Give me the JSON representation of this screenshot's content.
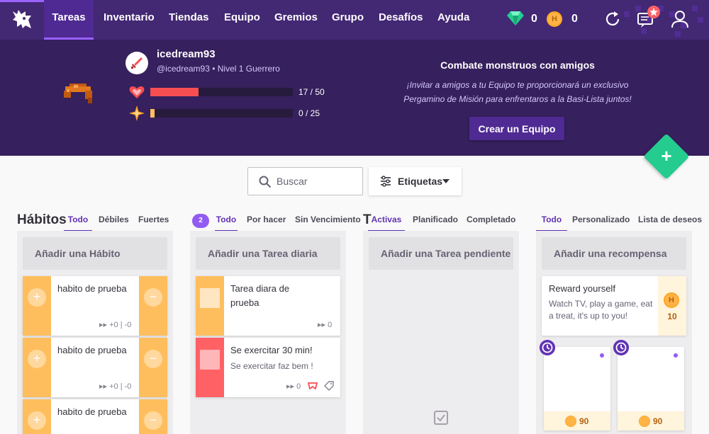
{
  "nav": {
    "items": [
      "Tareas",
      "Inventario",
      "Tiendas",
      "Equipo",
      "Gremios",
      "Grupo",
      "Desafíos",
      "Ayuda"
    ],
    "gems": "0",
    "gold": "0"
  },
  "user": {
    "name": "icedream93",
    "line": "@icedream93 • Nivel 1 Guerrero",
    "hp_text": "17 / 50",
    "hp_fraction": 0.34,
    "exp_text": "0 / 25",
    "exp_fraction": 0.03
  },
  "party": {
    "title": "Combate monstruos con amigos",
    "text": "¡Invitar a amigos a tu Equipo te proporcionará un exclusivo Pergamino de Misión para enfrentaros a la Basi-Lista juntos!",
    "button": "Crear un Equipo"
  },
  "search": {
    "placeholder": "Buscar"
  },
  "tags_label": "Etiquetas",
  "habits": {
    "title": "Hábitos",
    "filters": [
      "Todo",
      "Débiles",
      "Fuertes"
    ],
    "quick_add": "Añadir una Hábito",
    "items": [
      {
        "text": "habito de prueba",
        "meta": "+0 | -0"
      },
      {
        "text": "habito de prueba",
        "meta": "+0 | -0"
      },
      {
        "text": "habito de prueba"
      }
    ]
  },
  "dailies": {
    "badge": "2",
    "filters": [
      "Todo",
      "Por hacer",
      "Sin Vencimiento"
    ],
    "quick_add": "Añadir una Tarea diaria",
    "items": [
      {
        "text": "Tarea diara de prueba",
        "streak": "0",
        "color": "#ffbe5d",
        "check_color": "#ffe6c2"
      },
      {
        "text": "Se exercitar 30 min!",
        "note": "Se exercitar faz bem !",
        "streak": "0",
        "color": "#ff6165",
        "check_color": "#ffb6b8"
      }
    ]
  },
  "todos": {
    "title_partial": "T",
    "filters": [
      "Activas",
      "Planificado",
      "Completado"
    ],
    "quick_add": "Añadir una Tarea pendiente"
  },
  "rewards": {
    "filters": [
      "Todo",
      "Personalizado",
      "Lista de deseos"
    ],
    "quick_add": "Añadir una recompensa",
    "custom": {
      "title": "Reward yourself",
      "note": "Watch TV, play a game, eat a treat, it's up to you!",
      "price": "10"
    },
    "items": [
      {
        "price": "90"
      },
      {
        "price": "90"
      }
    ]
  }
}
